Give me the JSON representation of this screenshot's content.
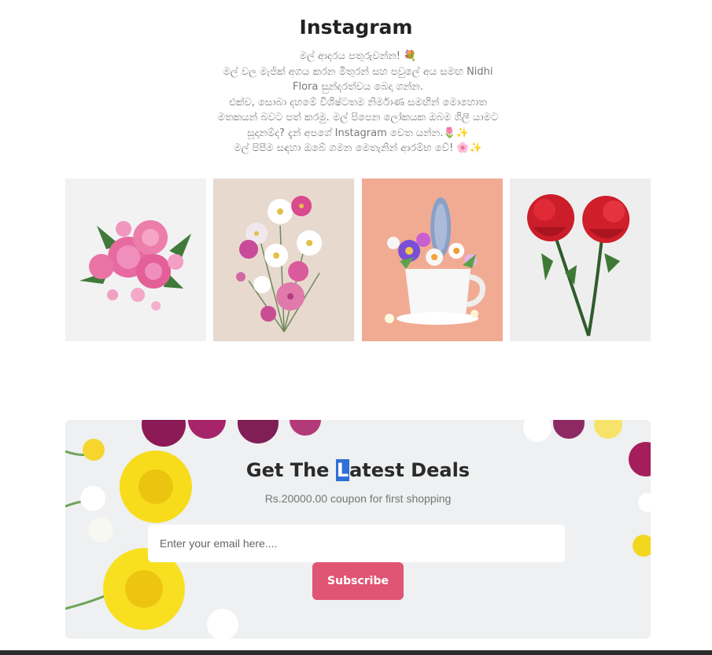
{
  "instagram": {
    "title": "Instagram",
    "description_lines": [
      "මල් ආදරය පතුරුවන්න! 💐",
      "මල් වල මැජික් අගය කරන මිතුරන් සහ පවුලේ අය සමඟ Nidhi",
      "Flora සුන්දරත්වය බෙදා ගන්න.",
      "එක්ව, සොබා දහමේ විශිෂ්ටතම නිර්මාණ සමඟින් මොහොත",
      "මතකයන් බවට පත් කරමු. මල් පිපෙන ලෝකයක ඔබම ගිලී යාමට",
      "සූදානම්ද? දැන් අපගේ Instagram වෙත යන්න.🌷✨",
      "මල් පිපීම සඳහා ඔබේ ගමන මෙතැනින් ආරම්භ වේ! 🌸✨"
    ],
    "images": [
      {
        "alt": "pink roses"
      },
      {
        "alt": "cosmos bouquet"
      },
      {
        "alt": "flowers in cup"
      },
      {
        "alt": "red roses"
      }
    ]
  },
  "deals": {
    "title_before": "Get The ",
    "title_highlight": "L",
    "title_after": "atest Deals",
    "subtitle": "Rs.20000.00 coupon for first shopping",
    "email_placeholder": "Enter your email here....",
    "subscribe_label": "Subscribe"
  },
  "colors": {
    "accent": "#e05574",
    "highlight": "#2f6fd6",
    "footer": "#2b2b2b"
  }
}
